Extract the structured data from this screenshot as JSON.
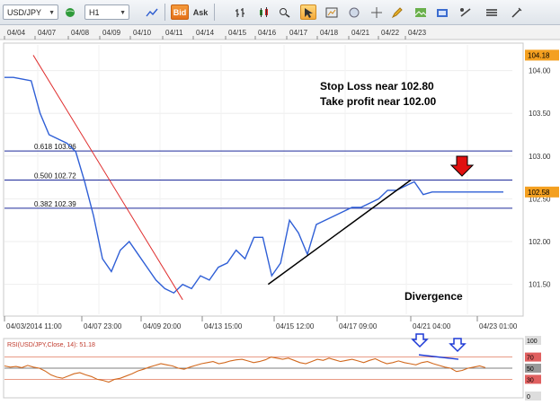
{
  "toolbar": {
    "symbol": "USD/JPY",
    "timeframe": "H1",
    "bid_label": "Bid",
    "ask_label": "Ask",
    "icons": [
      "dropdown-arrow-icon",
      "globe-icon",
      "bar-chart-icon",
      "candlestick-icon",
      "line-chart-icon",
      "zoom-in-icon",
      "zoom-out-icon",
      "magnifier-icon",
      "crosshair-icon",
      "cursor-icon",
      "drawing-icon",
      "pencil-icon",
      "image-icon",
      "settings-icon",
      "indicators-icon",
      "draw-tools-icon"
    ]
  },
  "chart_data": {
    "type": "line",
    "title": "",
    "top_dates": [
      "04/04",
      "04/07",
      "04/08",
      "04/09",
      "04/10",
      "04/11",
      "04/14",
      "04/15",
      "04/16",
      "04/17",
      "04/18",
      "04/21",
      "04/22",
      "04/23"
    ],
    "bottom_dates": [
      "04/03/2014 11:00",
      "04/07 23:00",
      "04/09 20:00",
      "04/13 15:00",
      "04/15 12:00",
      "04/17 09:00",
      "04/21 04:00",
      "04/23 01:00"
    ],
    "y_ticks": [
      "104.00",
      "103.50",
      "103.00",
      "102.50",
      "102.00",
      "101.50"
    ],
    "ylim": [
      101.15,
      104.3
    ],
    "current_price": "102.58",
    "high_label": "104.18",
    "price_series": {
      "name": "USD/JPY H1",
      "x_days": [
        0,
        0.5,
        1,
        1.5,
        2,
        2.5,
        3,
        3.5,
        4,
        4.5,
        5,
        5.5,
        6,
        6.5,
        7,
        7.5,
        8,
        8.5,
        9,
        9.5,
        10,
        10.5,
        11,
        11.5,
        12,
        12.5,
        13,
        13.5,
        14,
        14.5,
        15,
        15.5,
        16,
        16.5,
        17,
        17.5,
        18,
        18.5,
        19,
        19.5,
        20,
        20.5,
        21,
        21.5,
        22,
        22.5,
        23,
        23.5,
        24,
        24.5,
        25,
        25.5,
        26,
        26.5,
        27,
        27.5,
        28
      ],
      "values": [
        103.92,
        103.92,
        103.9,
        103.88,
        103.5,
        103.25,
        103.2,
        103.15,
        103.05,
        102.7,
        102.3,
        101.8,
        101.65,
        101.9,
        102.0,
        101.85,
        101.7,
        101.55,
        101.45,
        101.4,
        101.5,
        101.45,
        101.6,
        101.55,
        101.7,
        101.75,
        101.9,
        101.8,
        102.05,
        102.05,
        101.6,
        101.75,
        102.25,
        102.1,
        101.85,
        102.2,
        102.25,
        102.3,
        102.35,
        102.4,
        102.4,
        102.45,
        102.5,
        102.6,
        102.6,
        102.65,
        102.7,
        102.55,
        102.58,
        102.58,
        102.58,
        102.58,
        102.58,
        102.58,
        102.58,
        102.58,
        102.58
      ]
    },
    "fib_levels": [
      {
        "label": "0.618 103.06",
        "value": 103.06
      },
      {
        "label": "0.500 102.72",
        "value": 102.72
      },
      {
        "label": "0.382 102.39",
        "value": 102.39
      }
    ],
    "annotations": {
      "line1": "Stop Loss near 102.80",
      "line2": "Take profit near 102.00",
      "divergence": "Divergence"
    },
    "rsi": {
      "label": "RSI(USD/JPY,Close, 14): 51.18",
      "ticks": [
        "100",
        "70",
        "50",
        "30",
        "0"
      ],
      "ylim": [
        0,
        100
      ],
      "values": [
        54,
        52,
        53,
        51,
        55,
        52,
        50,
        45,
        38,
        34,
        32,
        36,
        40,
        42,
        38,
        35,
        30,
        28,
        25,
        30,
        32,
        36,
        40,
        45,
        48,
        52,
        55,
        58,
        56,
        54,
        50,
        48,
        52,
        55,
        58,
        60,
        62,
        58,
        60,
        63,
        65,
        66,
        63,
        60,
        62,
        65,
        70,
        68,
        66,
        68,
        64,
        60,
        58,
        62,
        66,
        64,
        68,
        65,
        62,
        64,
        66,
        63,
        60,
        64,
        67,
        62,
        58,
        60,
        63,
        60,
        58,
        56,
        60,
        62,
        58,
        55,
        52,
        50,
        44,
        46,
        50,
        52,
        54,
        51
      ]
    }
  },
  "colors": {
    "price_line": "#2f5fd6",
    "fib_line": "#1e2a9a",
    "trend_red": "#e03030",
    "trend_black": "#000000",
    "rsi_line": "#d2691e",
    "rsi_level": "#e07a5f",
    "arrow_blue": "#1e3ad6",
    "arrow_red": "#e01010",
    "current_price_bg": "#f4a020",
    "high_bg": "#f4a020"
  }
}
